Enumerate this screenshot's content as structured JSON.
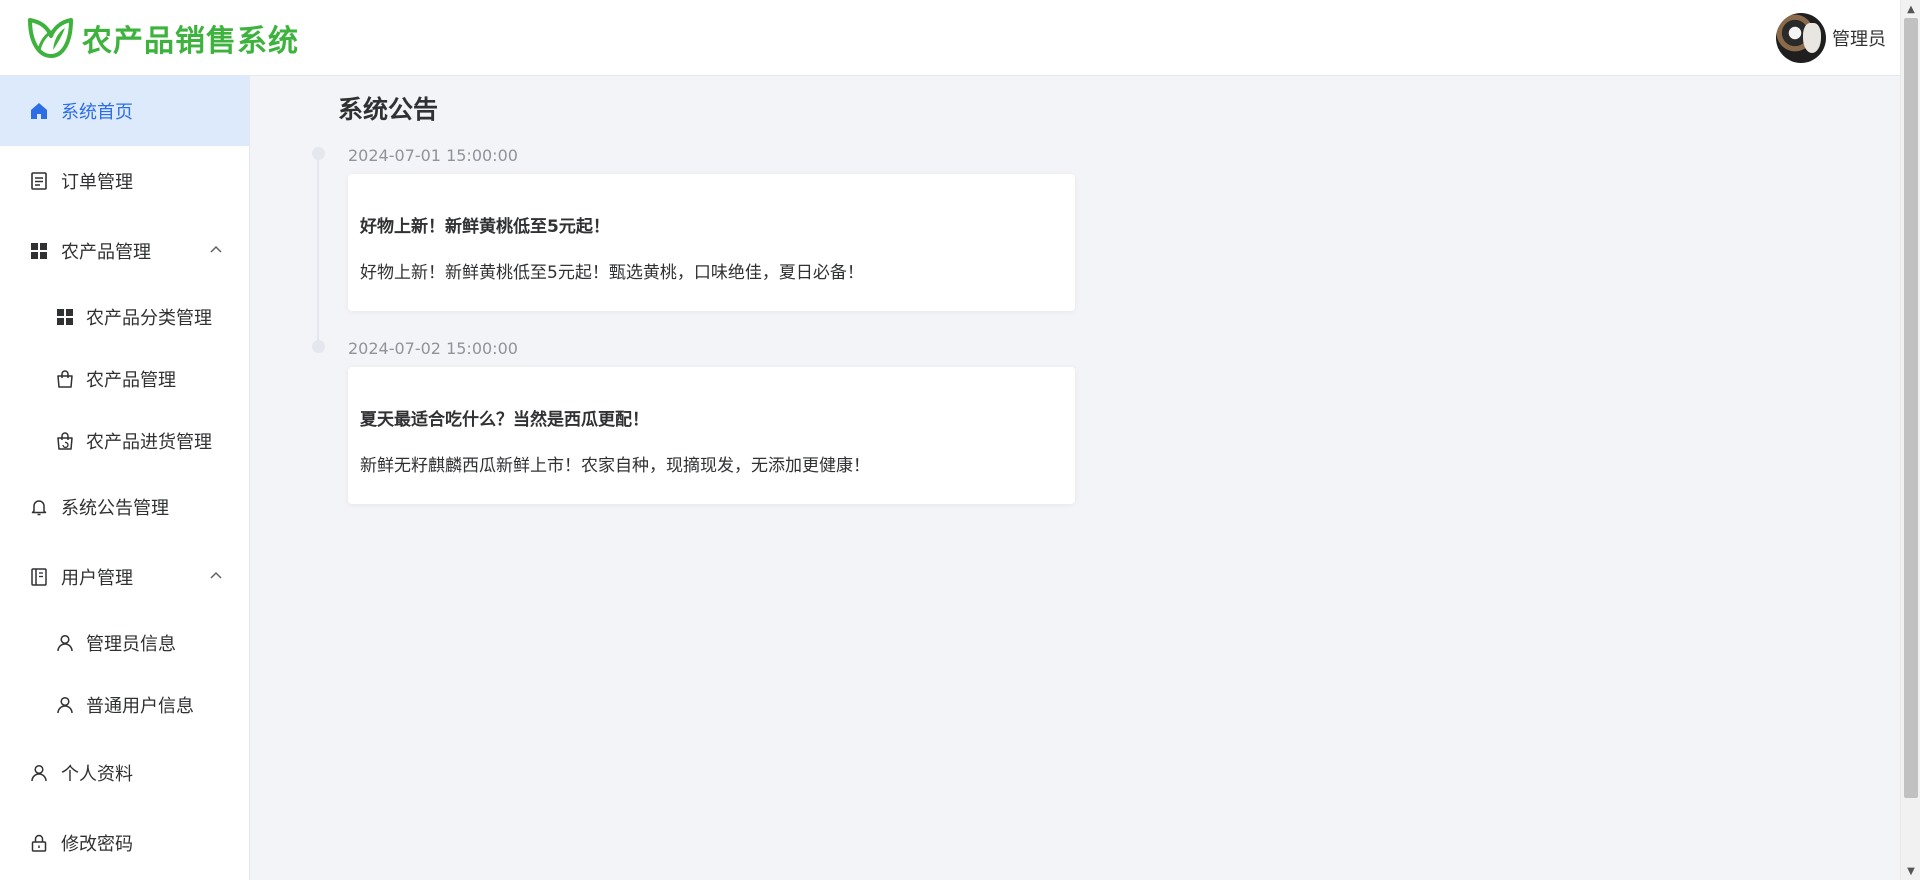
{
  "header": {
    "app_title": "农产品销售系统",
    "user_name": "管理员"
  },
  "sidebar": {
    "items": [
      {
        "label": "系统首页",
        "icon": "home-icon",
        "active": true
      },
      {
        "label": "订单管理",
        "icon": "document-icon"
      },
      {
        "label": "农产品管理",
        "icon": "grid-icon",
        "expanded": true,
        "children": [
          {
            "label": "农产品分类管理",
            "icon": "grid-icon"
          },
          {
            "label": "农产品管理",
            "icon": "shopping-bag-icon"
          },
          {
            "label": "农产品进货管理",
            "icon": "bag-refresh-icon"
          }
        ]
      },
      {
        "label": "系统公告管理",
        "icon": "bell-icon"
      },
      {
        "label": "用户管理",
        "icon": "notebook-icon",
        "expanded": true,
        "children": [
          {
            "label": "管理员信息",
            "icon": "user-icon"
          },
          {
            "label": "普通用户信息",
            "icon": "user-icon"
          }
        ]
      },
      {
        "label": "个人资料",
        "icon": "user-icon"
      },
      {
        "label": "修改密码",
        "icon": "lock-icon"
      }
    ]
  },
  "main": {
    "title": "系统公告",
    "notices": [
      {
        "time": "2024-07-01 15:00:00",
        "title": "好物上新！新鲜黄桃低至5元起！",
        "content": "好物上新！新鲜黄桃低至5元起！甄选黄桃，口味绝佳，夏日必备！"
      },
      {
        "time": "2024-07-02 15:00:00",
        "title": "夏天最适合吃什么？当然是西瓜更配！",
        "content": "新鲜无籽麒麟西瓜新鲜上市！农家自种，现摘现发，无添加更健康！"
      }
    ]
  },
  "colors": {
    "brand_green": "#3db23d",
    "active_blue": "#2d6ee6",
    "active_bg": "#dceafc",
    "page_bg": "#f3f4f8"
  }
}
